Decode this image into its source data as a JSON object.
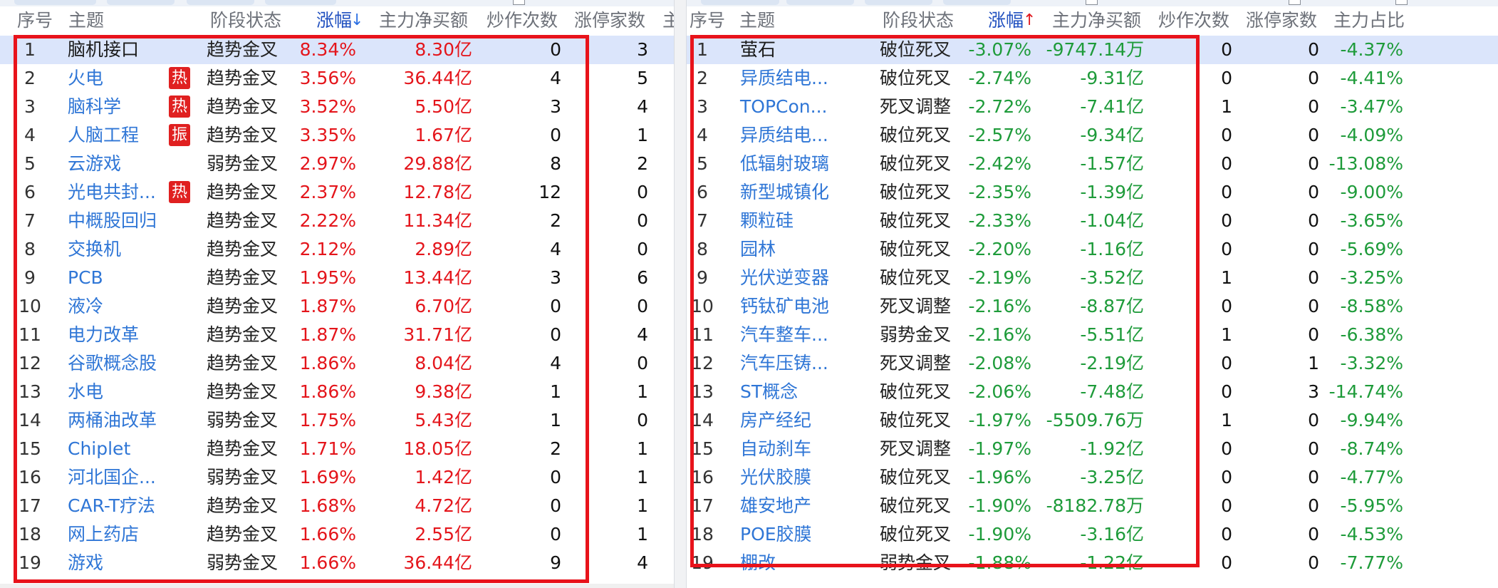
{
  "left": {
    "headers": {
      "index": "序号",
      "theme": "主题",
      "stage": "阶段状态",
      "change": "涨幅",
      "change_arrow": "↓",
      "net_buy": "主力净买额",
      "hype_count": "炒作次数",
      "limit_up_count": "涨停家数",
      "extra": "主"
    },
    "rows": [
      {
        "index": "1",
        "name": "脑机接口",
        "tag": "",
        "stage": "趋势金叉",
        "change": "8.34%",
        "net_buy": "8.30亿",
        "hype": "0",
        "limit_up": "3",
        "selected": true
      },
      {
        "index": "2",
        "name": "火电",
        "tag": "热",
        "stage": "趋势金叉",
        "change": "3.56%",
        "net_buy": "36.44亿",
        "hype": "4",
        "limit_up": "5",
        "selected": false
      },
      {
        "index": "3",
        "name": "脑科学",
        "tag": "热",
        "stage": "趋势金叉",
        "change": "3.52%",
        "net_buy": "5.50亿",
        "hype": "3",
        "limit_up": "4",
        "selected": false
      },
      {
        "index": "4",
        "name": "人脑工程",
        "tag": "振",
        "stage": "趋势金叉",
        "change": "3.35%",
        "net_buy": "1.67亿",
        "hype": "0",
        "limit_up": "1",
        "selected": false
      },
      {
        "index": "5",
        "name": "云游戏",
        "tag": "",
        "stage": "弱势金叉",
        "change": "2.97%",
        "net_buy": "29.88亿",
        "hype": "8",
        "limit_up": "2",
        "selected": false
      },
      {
        "index": "6",
        "name": "光电共封...",
        "tag": "热",
        "stage": "趋势金叉",
        "change": "2.37%",
        "net_buy": "12.78亿",
        "hype": "12",
        "limit_up": "0",
        "selected": false
      },
      {
        "index": "7",
        "name": "中概股回归",
        "tag": "",
        "stage": "趋势金叉",
        "change": "2.22%",
        "net_buy": "11.34亿",
        "hype": "2",
        "limit_up": "0",
        "selected": false
      },
      {
        "index": "8",
        "name": "交换机",
        "tag": "",
        "stage": "趋势金叉",
        "change": "2.12%",
        "net_buy": "2.89亿",
        "hype": "4",
        "limit_up": "0",
        "selected": false
      },
      {
        "index": "9",
        "name": "PCB",
        "tag": "",
        "stage": "趋势金叉",
        "change": "1.95%",
        "net_buy": "13.44亿",
        "hype": "3",
        "limit_up": "6",
        "selected": false
      },
      {
        "index": "10",
        "name": "液冷",
        "tag": "",
        "stage": "趋势金叉",
        "change": "1.87%",
        "net_buy": "6.70亿",
        "hype": "0",
        "limit_up": "0",
        "selected": false
      },
      {
        "index": "11",
        "name": "电力改革",
        "tag": "",
        "stage": "趋势金叉",
        "change": "1.87%",
        "net_buy": "31.71亿",
        "hype": "0",
        "limit_up": "4",
        "selected": false
      },
      {
        "index": "12",
        "name": "谷歌概念股",
        "tag": "",
        "stage": "趋势金叉",
        "change": "1.86%",
        "net_buy": "8.04亿",
        "hype": "4",
        "limit_up": "0",
        "selected": false
      },
      {
        "index": "13",
        "name": "水电",
        "tag": "",
        "stage": "趋势金叉",
        "change": "1.86%",
        "net_buy": "9.38亿",
        "hype": "1",
        "limit_up": "1",
        "selected": false
      },
      {
        "index": "14",
        "name": "两桶油改革",
        "tag": "",
        "stage": "弱势金叉",
        "change": "1.75%",
        "net_buy": "5.43亿",
        "hype": "1",
        "limit_up": "0",
        "selected": false
      },
      {
        "index": "15",
        "name": "Chiplet",
        "tag": "",
        "stage": "趋势金叉",
        "change": "1.71%",
        "net_buy": "18.05亿",
        "hype": "2",
        "limit_up": "1",
        "selected": false
      },
      {
        "index": "16",
        "name": "河北国企...",
        "tag": "",
        "stage": "弱势金叉",
        "change": "1.69%",
        "net_buy": "1.42亿",
        "hype": "0",
        "limit_up": "1",
        "selected": false
      },
      {
        "index": "17",
        "name": "CAR-T疗法",
        "tag": "",
        "stage": "趋势金叉",
        "change": "1.68%",
        "net_buy": "4.72亿",
        "hype": "0",
        "limit_up": "1",
        "selected": false
      },
      {
        "index": "18",
        "name": "网上药店",
        "tag": "",
        "stage": "趋势金叉",
        "change": "1.66%",
        "net_buy": "2.55亿",
        "hype": "0",
        "limit_up": "1",
        "selected": false
      },
      {
        "index": "19",
        "name": "游戏",
        "tag": "",
        "stage": "弱势金叉",
        "change": "1.66%",
        "net_buy": "36.44亿",
        "hype": "9",
        "limit_up": "4",
        "selected": false
      }
    ]
  },
  "right": {
    "headers": {
      "index": "序号",
      "theme": "主题",
      "stage": "阶段状态",
      "change": "涨幅",
      "change_arrow": "↑",
      "net_buy": "主力净买额",
      "hype_count": "炒作次数",
      "limit_up_count": "涨停家数",
      "main_ratio": "主力占比"
    },
    "rows": [
      {
        "index": "1",
        "name": "萤石",
        "stage": "破位死叉",
        "change": "-3.07%",
        "net_buy": "-9747.14万",
        "hype": "0",
        "limit_up": "0",
        "ratio": "-4.37%",
        "selected": true
      },
      {
        "index": "2",
        "name": "异质结电...",
        "stage": "破位死叉",
        "change": "-2.74%",
        "net_buy": "-9.31亿",
        "hype": "0",
        "limit_up": "0",
        "ratio": "-4.41%",
        "selected": false
      },
      {
        "index": "3",
        "name": "TOPCon...",
        "stage": "死叉调整",
        "change": "-2.72%",
        "net_buy": "-7.41亿",
        "hype": "1",
        "limit_up": "0",
        "ratio": "-3.47%",
        "selected": false
      },
      {
        "index": "4",
        "name": "异质结电...",
        "stage": "破位死叉",
        "change": "-2.57%",
        "net_buy": "-9.34亿",
        "hype": "0",
        "limit_up": "0",
        "ratio": "-4.09%",
        "selected": false
      },
      {
        "index": "5",
        "name": "低辐射玻璃",
        "stage": "破位死叉",
        "change": "-2.42%",
        "net_buy": "-1.57亿",
        "hype": "0",
        "limit_up": "0",
        "ratio": "-13.08%",
        "selected": false
      },
      {
        "index": "6",
        "name": "新型城镇化",
        "stage": "破位死叉",
        "change": "-2.35%",
        "net_buy": "-1.39亿",
        "hype": "0",
        "limit_up": "0",
        "ratio": "-9.00%",
        "selected": false
      },
      {
        "index": "7",
        "name": "颗粒硅",
        "stage": "破位死叉",
        "change": "-2.33%",
        "net_buy": "-1.04亿",
        "hype": "0",
        "limit_up": "0",
        "ratio": "-3.65%",
        "selected": false
      },
      {
        "index": "8",
        "name": "园林",
        "stage": "破位死叉",
        "change": "-2.20%",
        "net_buy": "-1.16亿",
        "hype": "0",
        "limit_up": "0",
        "ratio": "-5.69%",
        "selected": false
      },
      {
        "index": "9",
        "name": "光伏逆变器",
        "stage": "破位死叉",
        "change": "-2.19%",
        "net_buy": "-3.52亿",
        "hype": "1",
        "limit_up": "0",
        "ratio": "-3.25%",
        "selected": false
      },
      {
        "index": "10",
        "name": "钙钛矿电池",
        "stage": "死叉调整",
        "change": "-2.16%",
        "net_buy": "-8.87亿",
        "hype": "0",
        "limit_up": "0",
        "ratio": "-8.58%",
        "selected": false
      },
      {
        "index": "11",
        "name": "汽车整车...",
        "stage": "弱势金叉",
        "change": "-2.16%",
        "net_buy": "-5.51亿",
        "hype": "1",
        "limit_up": "0",
        "ratio": "-6.38%",
        "selected": false
      },
      {
        "index": "12",
        "name": "汽车压铸...",
        "stage": "死叉调整",
        "change": "-2.08%",
        "net_buy": "-2.19亿",
        "hype": "0",
        "limit_up": "1",
        "ratio": "-3.32%",
        "selected": false
      },
      {
        "index": "13",
        "name": "ST概念",
        "stage": "破位死叉",
        "change": "-2.06%",
        "net_buy": "-7.48亿",
        "hype": "0",
        "limit_up": "3",
        "ratio": "-14.74%",
        "selected": false
      },
      {
        "index": "14",
        "name": "房产经纪",
        "stage": "破位死叉",
        "change": "-1.97%",
        "net_buy": "-5509.76万",
        "hype": "1",
        "limit_up": "0",
        "ratio": "-9.94%",
        "selected": false
      },
      {
        "index": "15",
        "name": "自动刹车",
        "stage": "死叉调整",
        "change": "-1.97%",
        "net_buy": "-1.92亿",
        "hype": "0",
        "limit_up": "0",
        "ratio": "-8.74%",
        "selected": false
      },
      {
        "index": "16",
        "name": "光伏胶膜",
        "stage": "破位死叉",
        "change": "-1.96%",
        "net_buy": "-3.25亿",
        "hype": "0",
        "limit_up": "0",
        "ratio": "-4.77%",
        "selected": false
      },
      {
        "index": "17",
        "name": "雄安地产",
        "stage": "破位死叉",
        "change": "-1.90%",
        "net_buy": "-8182.78万",
        "hype": "0",
        "limit_up": "0",
        "ratio": "-5.95%",
        "selected": false
      },
      {
        "index": "18",
        "name": "POE胶膜",
        "stage": "破位死叉",
        "change": "-1.90%",
        "net_buy": "-3.16亿",
        "hype": "0",
        "limit_up": "0",
        "ratio": "-4.53%",
        "selected": false
      },
      {
        "index": "19",
        "name": "棚改",
        "stage": "弱势金叉",
        "change": "-1.88%",
        "net_buy": "-1.22亿",
        "hype": "0",
        "limit_up": "0",
        "ratio": "-7.77%",
        "selected": false
      }
    ]
  },
  "colors": {
    "up": "#e4151b",
    "down": "#1e9b3a",
    "link": "#2f76d6",
    "highlight_border": "#e8131b",
    "selected_row": "#dbe5fb",
    "tag_bg": "#e02020"
  }
}
